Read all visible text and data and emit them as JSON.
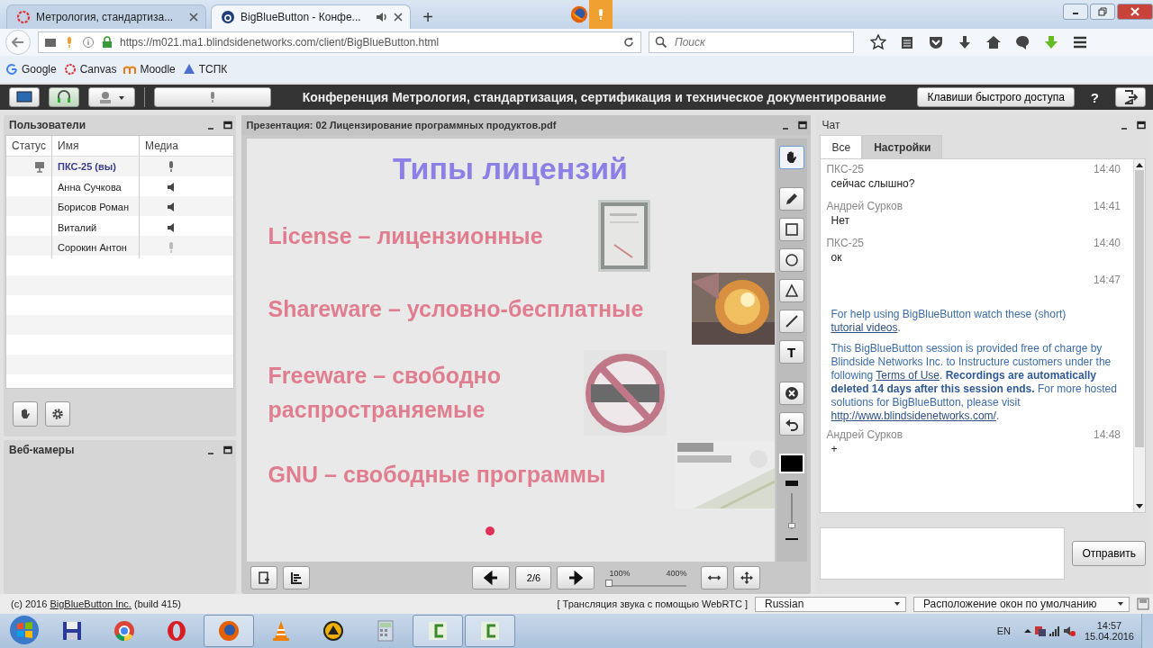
{
  "browser": {
    "tabs": [
      {
        "title": "Метрология, стандартиза...",
        "selected": false,
        "audio": false
      },
      {
        "title": "BigBlueButton - Конфе...",
        "selected": true,
        "audio": true
      }
    ],
    "new_tab": "+",
    "url": "https://m021.ma1.blindsidenetworks.com/client/BigBlueButton.html",
    "search": {
      "placeholder": "Поиск"
    },
    "bookmarks": [
      {
        "kind": "google",
        "label": "Google"
      },
      {
        "kind": "canvas",
        "label": "Canvas"
      },
      {
        "kind": "moodle",
        "label": "Moodle"
      },
      {
        "kind": "triangle",
        "label": "ТСПК"
      }
    ]
  },
  "toolbar": {
    "title": "Конференция Метрология, стандартизация, сертификация и техническое документирование",
    "shortcuts_button": "Клавиши быстрого доступа",
    "help": "?"
  },
  "users": {
    "title": "Пользователи",
    "columns": [
      "Статус",
      "Имя",
      "Медиа"
    ],
    "rows": [
      {
        "name": "ПКС-25 (вы)",
        "current": true,
        "presenter": true,
        "kind": "microphone"
      },
      {
        "name": "Анна Сучкова",
        "current": false,
        "presenter": false,
        "kind": "speaker"
      },
      {
        "name": "Борисов Роман",
        "current": false,
        "presenter": false,
        "kind": "speaker"
      },
      {
        "name": "Виталий",
        "current": false,
        "presenter": false,
        "kind": "speaker"
      },
      {
        "name": "Сорокин  Антон",
        "current": false,
        "presenter": false,
        "kind": "muted"
      }
    ]
  },
  "webcams": {
    "title": "Веб-камеры"
  },
  "presentation": {
    "title": "Презентация: 02 Лицензирование программных продуктов.pdf",
    "slide": {
      "heading": "Типы лицензий",
      "items": [
        "License – лицензионные",
        "Shareware – условно-бесплатные",
        "Freeware – свободно распространяемые",
        "GNU – свободные программы"
      ]
    },
    "tools": [
      {
        "kind": "hand",
        "selected": true
      },
      {
        "kind": "pencil",
        "selected": false
      },
      {
        "kind": "rectangle",
        "selected": false
      },
      {
        "kind": "ellipse",
        "selected": false
      },
      {
        "kind": "triangle",
        "selected": false
      },
      {
        "kind": "line",
        "selected": false
      },
      {
        "kind": "text",
        "label": "T",
        "selected": false
      },
      {
        "kind": "clear",
        "selected": false
      },
      {
        "kind": "undo",
        "selected": false
      }
    ],
    "color": "#000000",
    "thickness": {
      "level": 0.1
    },
    "page": "2/6",
    "zoom_min": "100%",
    "zoom_max": "400%",
    "zoom": {
      "level": 0
    }
  },
  "chat": {
    "title": "Чат",
    "tabs": [
      {
        "label": "Все",
        "selected": true
      },
      {
        "label": "Настройки",
        "selected": false
      }
    ],
    "messages": [
      {
        "kind": "user",
        "sender": "ПКС-25",
        "time": "14:40",
        "text": "сейчас слышно?"
      },
      {
        "kind": "user",
        "sender": "Андрей Сурков",
        "time": "14:41",
        "text": "Нет"
      },
      {
        "kind": "user",
        "sender": "ПКС-25",
        "time": "14:40",
        "text": "ок"
      },
      {
        "kind": "system",
        "time": "14:47",
        "paragraphs": [
          [
            {
              "kind": "text",
              "text": "For help using BigBlueButton watch these (short) "
            },
            {
              "kind": "link",
              "text": "tutorial videos"
            },
            {
              "kind": "text",
              "text": "."
            }
          ],
          [
            {
              "kind": "text",
              "text": "This BigBlueButton session is provided free of charge by Blindside Networks Inc. to Instructure customers under the following "
            },
            {
              "kind": "link",
              "text": "Terms of Use"
            },
            {
              "kind": "text",
              "text": ".  "
            },
            {
              "kind": "bold",
              "text": "Recordings are automatically deleted 14 days after this session ends."
            },
            {
              "kind": "text",
              "text": " For more hosted solutions for BigBlueButton, please visit "
            },
            {
              "kind": "link",
              "text": "http://www.blindsidenetworks.com/"
            },
            {
              "kind": "text",
              "text": "."
            }
          ]
        ]
      },
      {
        "kind": "user",
        "sender": "Андрей Сурков",
        "time": "14:48",
        "text": "+"
      }
    ],
    "send_button": "Отправить"
  },
  "footer": {
    "copyright": [
      {
        "kind": "text",
        "text": "(c) 2016 "
      },
      {
        "kind": "link",
        "text": "BigBlueButton Inc."
      },
      {
        "kind": "text",
        "text": " (build 415)"
      }
    ],
    "audio_note": "[ Трансляция звука с помощью WebRTC ]",
    "language": "Russian",
    "layout": "Расположение окон по умолчанию"
  },
  "taskbar": {
    "apps": [
      {
        "kind": "floppy",
        "selected": false
      },
      {
        "kind": "chrome",
        "selected": false
      },
      {
        "kind": "opera",
        "selected": false
      },
      {
        "kind": "firefox",
        "selected": true
      },
      {
        "kind": "cone",
        "selected": false
      },
      {
        "kind": "triangle",
        "selected": false
      },
      {
        "kind": "calculator",
        "selected": false
      },
      {
        "kind": "camtasia",
        "selected": true
      },
      {
        "kind": "camtasia",
        "selected": true
      }
    ],
    "language": "EN",
    "time": "14:57",
    "date": "15.04.2016"
  }
}
